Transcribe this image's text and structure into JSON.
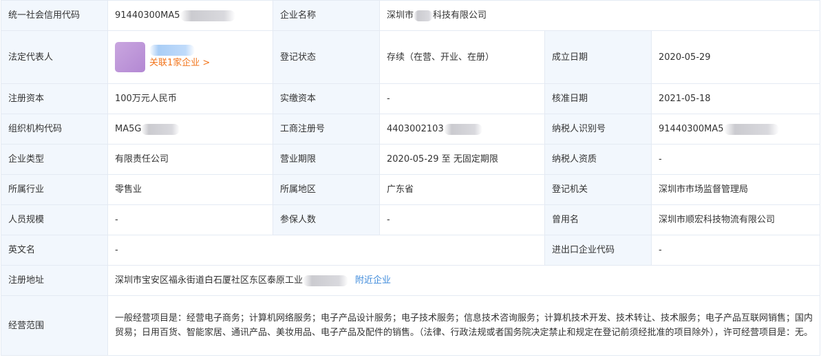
{
  "rows": {
    "credit_code": {
      "label": "统一社会信用代码",
      "value": "91440300MA5"
    },
    "company_name": {
      "label": "企业名称",
      "value_prefix": "深圳市",
      "value_suffix": "科技有限公司"
    },
    "legal_rep": {
      "label": "法定代表人",
      "link": "关联1家企业 >"
    },
    "status": {
      "label": "登记状态",
      "value": "存续（在营、开业、在册）"
    },
    "found_date": {
      "label": "成立日期",
      "value": "2020-05-29"
    },
    "reg_capital": {
      "label": "注册资本",
      "value": "100万元人民币"
    },
    "paid_capital": {
      "label": "实缴资本",
      "value": "-"
    },
    "approve_date": {
      "label": "核准日期",
      "value": "2021-05-18"
    },
    "org_code": {
      "label": "组织机构代码",
      "value": "MA5G"
    },
    "reg_no": {
      "label": "工商注册号",
      "value": "4403002103"
    },
    "taxpayer_id": {
      "label": "纳税人识别号",
      "value": "91440300MA5"
    },
    "company_type": {
      "label": "企业类型",
      "value": "有限责任公司"
    },
    "biz_term": {
      "label": "营业期限",
      "value": "2020-05-29 至 无固定期限"
    },
    "taxpayer_qual": {
      "label": "纳税人资质",
      "value": "-"
    },
    "industry": {
      "label": "所属行业",
      "value": "零售业"
    },
    "region": {
      "label": "所属地区",
      "value": "广东省"
    },
    "reg_authority": {
      "label": "登记机关",
      "value": "深圳市市场监督管理局"
    },
    "staff_size": {
      "label": "人员规模",
      "value": "-"
    },
    "insured": {
      "label": "参保人数",
      "value": "-"
    },
    "former_name": {
      "label": "曾用名",
      "value": "深圳市顺宏科技物流有限公司"
    },
    "english_name": {
      "label": "英文名",
      "value": "-"
    },
    "import_export": {
      "label": "进出口企业代码",
      "value": "-"
    },
    "address": {
      "label": "注册地址",
      "value": "深圳市宝安区福永街道白石厦社区东区泰原工业",
      "link": "附近企业"
    },
    "scope": {
      "label": "经营范围",
      "value": "一般经营项目是：经营电子商务；计算机网络服务；电子产品设计服务；电子技术服务；信息技术咨询服务；计算机技术开发、技术转让、技术服务；电子产品互联网销售；国内贸易；日用百货、智能家居、通讯产品、美妆用品、电子产品及配件的销售。（法律、行政法规或者国务院决定禁止和规定在登记前须经批准的项目除外），许可经营项目是：无。"
    }
  },
  "colors": {
    "label_bg": "#f2f7fd",
    "border": "#e4eaf3",
    "link_orange": "#f2751c",
    "link_blue": "#3d8adb"
  }
}
